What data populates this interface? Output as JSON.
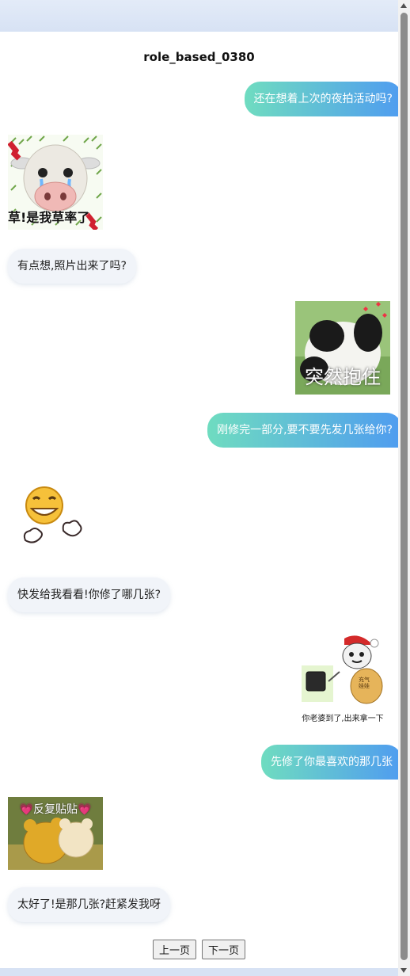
{
  "page": {
    "title": "role_based_0380"
  },
  "messages": [
    {
      "side": "me",
      "type": "text",
      "text": "还在想着上次的夜拍活动吗?"
    },
    {
      "side": "other",
      "type": "sticker",
      "sticker": "cow-crying-sticker",
      "caption": "草!是我草率了"
    },
    {
      "side": "other",
      "type": "text",
      "text": "有点想,照片出来了吗?"
    },
    {
      "side": "me",
      "type": "sticker",
      "sticker": "panda-hug-sticker",
      "caption": "突然抱住"
    },
    {
      "side": "me",
      "type": "text",
      "text": "刚修完一部分,要不要先发几张给你?"
    },
    {
      "side": "other",
      "type": "sticker",
      "sticker": "grinning-clapping-emoji-sticker",
      "caption": ""
    },
    {
      "side": "other",
      "type": "text",
      "text": "快发给我看看!你修了哪几张?"
    },
    {
      "side": "me",
      "type": "sticker",
      "sticker": "santa-meme-sticker",
      "caption": "你老婆到了,出来拿一下",
      "bag_text": "充气娃娃"
    },
    {
      "side": "me",
      "type": "text",
      "text": "先修了你最喜欢的那几张"
    },
    {
      "side": "other",
      "type": "sticker",
      "sticker": "bears-cuddling-sticker",
      "caption": "💗反复贴贴💗"
    },
    {
      "side": "other",
      "type": "text",
      "text": "太好了!是那几张?赶紧发我呀"
    }
  ],
  "pagination": {
    "prev_label": "上一页",
    "next_label": "下一页"
  },
  "colors": {
    "me_bubble_start": "#6fdcc0",
    "me_bubble_end": "#4f9cf0",
    "other_bubble": "#f1f4f9"
  }
}
